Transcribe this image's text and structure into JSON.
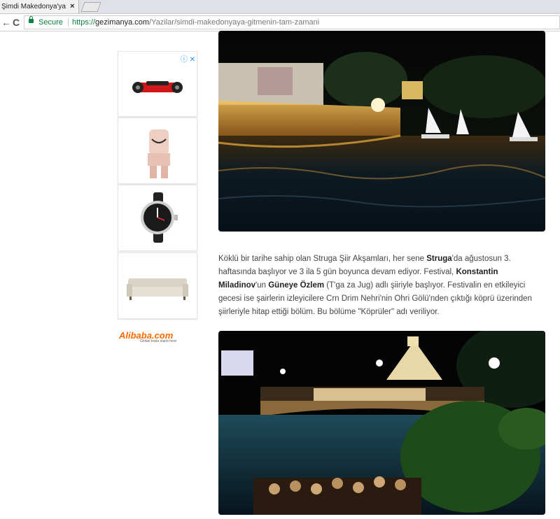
{
  "browser": {
    "tab_title": "Şimdi Makedonya'ya gitmenin tam zamanı",
    "tab_close": "×",
    "back": "←",
    "reload": "C",
    "secure_label": "Secure",
    "url_protocol": "https://",
    "url_host": "gezimanya.com",
    "url_path": "/Yazilar/simdi-makedonyaya-gitmenin-tam-zamani"
  },
  "ads": {
    "adchoices": "ⓘ ✕",
    "brand": "Alibaba.com",
    "brand_tagline": "Global trade starts here"
  },
  "article": {
    "paragraph": [
      "Köklü bir tarihe sahip olan Struga Şiir Akşamları, her sene ",
      "Struga",
      "'da ağustosun 3. haftasında başlıyor ve 3 ila 5 gün boyunca devam ediyor. Festival, ",
      "Konstantin Miladinov",
      "'un ",
      "Güneye Özlem",
      " (T'ga za Jug) adlı şiiriyle başlıyor. Festivalin en etkileyici gecesi ise şairlerin izleyicilere Crn Drim Nehri'nin Ohri Gölü'nden çıktığı köprü üzerinden şiirleriyle hitap ettiği bölüm. Bu bölüme \"Köprüler\" adı veriliyor."
    ]
  }
}
